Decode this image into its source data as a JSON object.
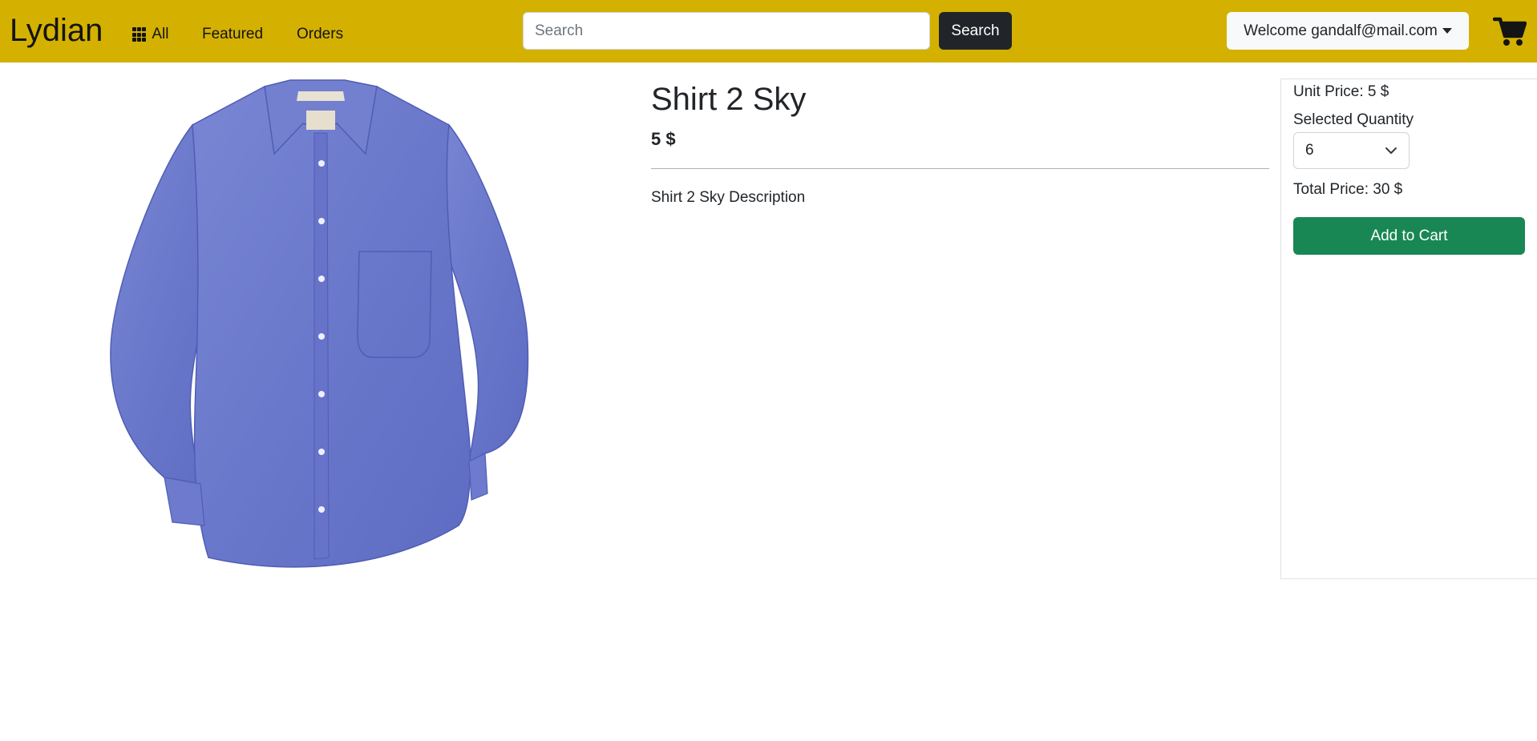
{
  "navbar": {
    "brand": "Lydian",
    "links": {
      "all": "All",
      "featured": "Featured",
      "orders": "Orders"
    },
    "search": {
      "placeholder": "Search",
      "value": "",
      "button_label": "Search"
    },
    "user_menu": {
      "label": "Welcome gandalf@mail.com"
    },
    "icons": {
      "all": "grid-icon",
      "user_menu": "caret-down-icon",
      "cart": "cart-icon"
    },
    "background_color": "#d4b100"
  },
  "product": {
    "title": "Shirt 2 Sky",
    "price": "5 $",
    "description": "Shirt 2 Sky Description",
    "image": "blue oxford long-sleeve button-down shirt"
  },
  "order": {
    "unit_price": "Unit Price: 5 $",
    "quantity_label": "Selected Quantity",
    "quantity_value": "6",
    "total_price": "Total Price: 30 $",
    "add_to_cart_label": "Add to Cart",
    "add_to_cart_color": "#198754"
  }
}
